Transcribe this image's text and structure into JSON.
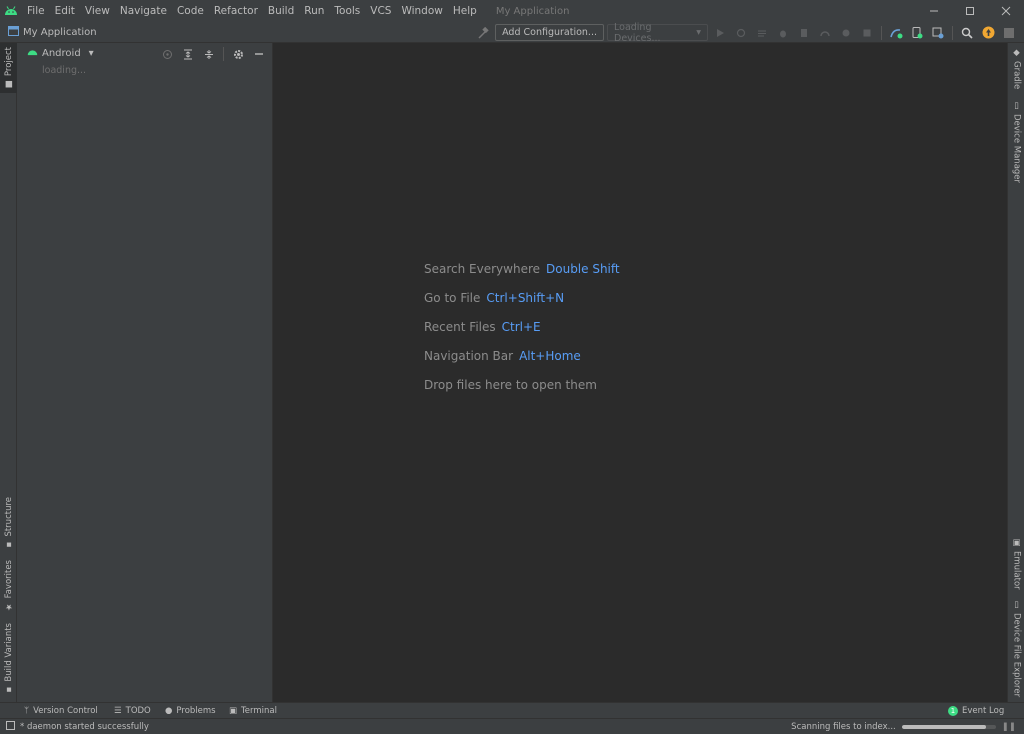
{
  "titlebar": {
    "menu": [
      "File",
      "Edit",
      "View",
      "Navigate",
      "Code",
      "Refactor",
      "Build",
      "Run",
      "Tools",
      "VCS",
      "Window",
      "Help"
    ],
    "window_title": "My Application",
    "controls": [
      "minimize-icon",
      "maximize-icon",
      "close-icon"
    ]
  },
  "navbar": {
    "project_name": "My Application",
    "add_config_label": "Add Configuration...",
    "devices_label": "Loading Devices..."
  },
  "left_tool_windows": {
    "project": "Project",
    "structure": "Structure",
    "favorites": "Favorites",
    "build_variants": "Build Variants"
  },
  "right_tool_windows": {
    "gradle": "Gradle",
    "device_manager": "Device Manager",
    "emulator": "Emulator",
    "device_file_explorer": "Device File Explorer"
  },
  "project_panel": {
    "view_mode": "Android",
    "loading_text": "loading..."
  },
  "editor_hints": [
    {
      "label": "Search Everywhere",
      "key": "Double Shift"
    },
    {
      "label": "Go to File",
      "key": "Ctrl+Shift+N"
    },
    {
      "label": "Recent Files",
      "key": "Ctrl+E"
    },
    {
      "label": "Navigation Bar",
      "key": "Alt+Home"
    },
    {
      "label": "Drop files here to open them",
      "key": ""
    }
  ],
  "bottom_tabs": {
    "version_control": "Version Control",
    "todo": "TODO",
    "problems": "Problems",
    "terminal": "Terminal",
    "event_log": "Event Log",
    "event_log_count": "1"
  },
  "status": {
    "message": "* daemon started successfully",
    "indexing": "Scanning files to index...",
    "progress": 0.9
  },
  "colors": {
    "android_green": "#3ddc84",
    "key_blue": "#589df6",
    "update_orange": "#f0a732"
  }
}
